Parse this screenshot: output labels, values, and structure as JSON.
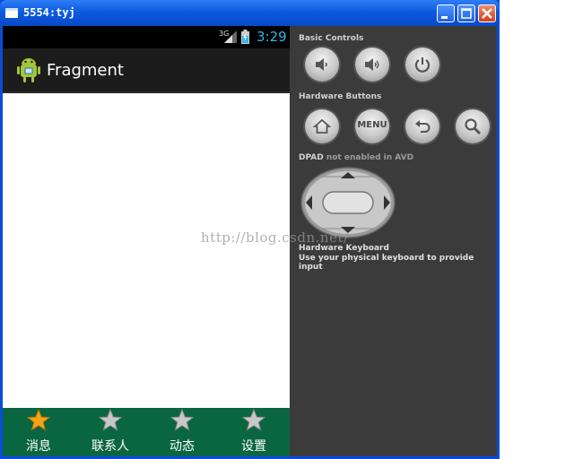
{
  "window": {
    "title": "5554:tyj"
  },
  "phone": {
    "status_bar": {
      "network": "3G",
      "time": "3:29"
    },
    "action_bar": {
      "title": "Fragment"
    },
    "tabs": [
      {
        "label": "消息",
        "icon": "star-selected-icon",
        "selected": true
      },
      {
        "label": "联系人",
        "icon": "star-icon",
        "selected": false
      },
      {
        "label": "动态",
        "icon": "star-icon",
        "selected": false
      },
      {
        "label": "设置",
        "icon": "star-icon",
        "selected": false
      }
    ]
  },
  "controls": {
    "basic_controls_label": "Basic Controls",
    "hardware_buttons_label": "Hardware Buttons",
    "menu_label": "MENU",
    "dpad_label": "DPAD",
    "dpad_note": "not enabled in AVD",
    "keyboard_title": "Hardware Keyboard",
    "keyboard_desc": "Use your physical keyboard to provide input"
  },
  "watermark": "http://blog.csdn.net/",
  "colors": {
    "tab_bar": "#0a6641",
    "panel": "#3b3b3b",
    "clock": "#33b5e5",
    "title_bar": "#0b5be0"
  }
}
